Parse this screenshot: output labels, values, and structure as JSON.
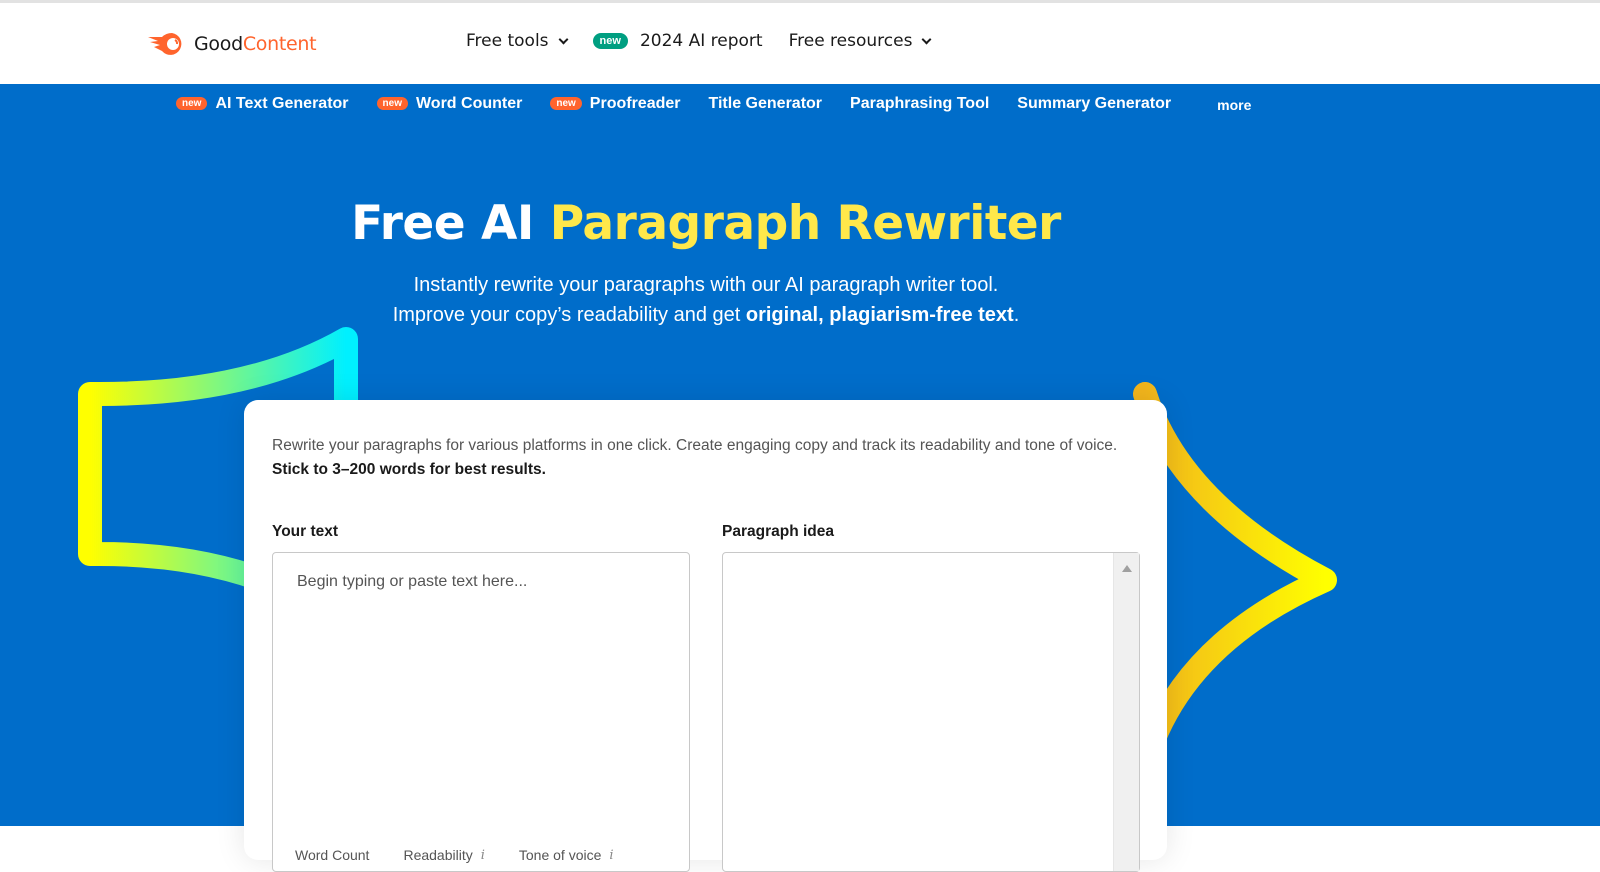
{
  "header": {
    "logo": {
      "part1": "Good",
      "part2": "Content"
    },
    "nav": [
      {
        "label": "Free tools",
        "has_dropdown": true
      },
      {
        "badge": "new",
        "label": "2024 AI report",
        "has_dropdown": false
      },
      {
        "label": "Free resources",
        "has_dropdown": true
      }
    ]
  },
  "toolnav": {
    "items": [
      {
        "badge": "new",
        "label": "AI Text Generator"
      },
      {
        "badge": "new",
        "label": "Word Counter"
      },
      {
        "badge": "new",
        "label": "Proofreader"
      },
      {
        "label": "Title Generator"
      },
      {
        "label": "Paraphrasing Tool"
      },
      {
        "label": "Summary Generator"
      }
    ],
    "more": "more"
  },
  "hero": {
    "title_white": "Free AI ",
    "title_yellow": "Paragraph Rewriter",
    "subtitle_line1": "Instantly rewrite your paragraphs with our AI paragraph writer tool.",
    "subtitle_line2_prefix": "Improve your copy’s readability and get ",
    "subtitle_line2_bold": "original, plagiarism-free text",
    "subtitle_line2_suffix": "."
  },
  "card": {
    "description": "Rewrite your paragraphs for various platforms in one click. Create engaging copy and track its readability and tone of voice. ",
    "description_bold": "Stick to 3–200 words for best results.",
    "input": {
      "label": "Your text",
      "placeholder": "Begin typing or paste text here...",
      "value": ""
    },
    "output": {
      "label": "Paragraph idea",
      "value": ""
    },
    "stats": [
      {
        "label": "Word Count",
        "info": false
      },
      {
        "label": "Readability",
        "info": true
      },
      {
        "label": "Tone of voice",
        "info": true
      }
    ]
  },
  "colors": {
    "brand_orange": "#ff642d",
    "hero_blue": "#006dca",
    "title_yellow": "#ffe84a",
    "badge_green": "#009f81"
  }
}
